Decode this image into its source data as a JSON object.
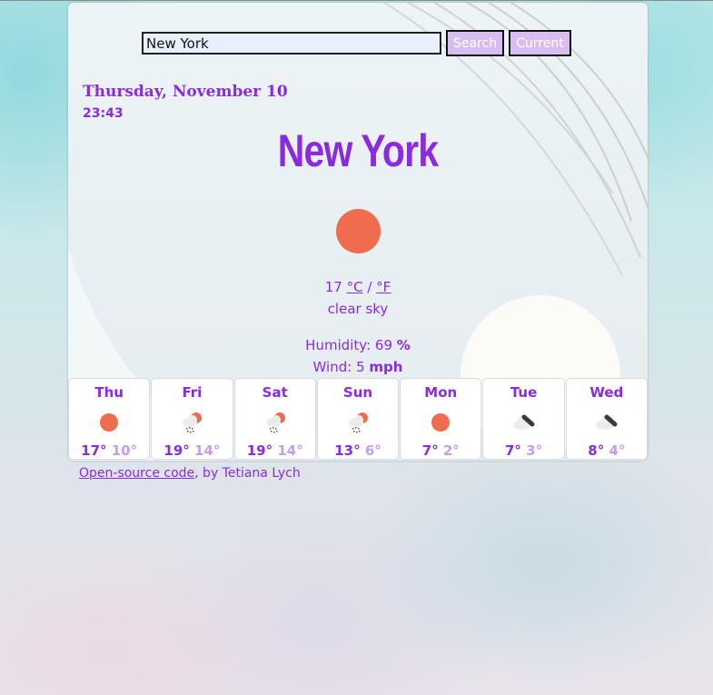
{
  "search": {
    "value": "New York",
    "search_label": "Search",
    "current_label": "Current"
  },
  "datetime": {
    "date": "Thursday, November 10",
    "time": "23:43"
  },
  "current": {
    "city": "New York",
    "icon": "sun-icon",
    "temperature": "17",
    "unit_celsius": "°C",
    "unit_separator": " / ",
    "unit_fahrenheit": "°F",
    "description": "clear sky",
    "humidity_label": "Humidity: ",
    "humidity_value": "69",
    "humidity_unit": "%",
    "wind_label": "Wind: ",
    "wind_value": "5",
    "wind_unit": "mph"
  },
  "forecast": [
    {
      "day": "Thu",
      "icon": "sun-icon",
      "max": "17°",
      "min": "10°"
    },
    {
      "day": "Fri",
      "icon": "rain-sun-icon",
      "max": "19°",
      "min": "14°"
    },
    {
      "day": "Sat",
      "icon": "rain-sun-icon",
      "max": "19°",
      "min": "14°"
    },
    {
      "day": "Sun",
      "icon": "rain-sun-icon",
      "max": "13°",
      "min": "6°"
    },
    {
      "day": "Mon",
      "icon": "sun-icon",
      "max": "7°",
      "min": "2°"
    },
    {
      "day": "Tue",
      "icon": "broken-clouds-icon",
      "max": "7°",
      "min": "3°"
    },
    {
      "day": "Wed",
      "icon": "broken-clouds-icon",
      "max": "8°",
      "min": "4°"
    }
  ],
  "footer": {
    "link_label": "Open-source code",
    "suffix": ", by Tetiana Lych"
  },
  "colors": {
    "accent": "#8a2be2",
    "accent_light": "#c49cf0",
    "sun": "#ef6c4e",
    "button_bg": "#d8bdf2"
  }
}
